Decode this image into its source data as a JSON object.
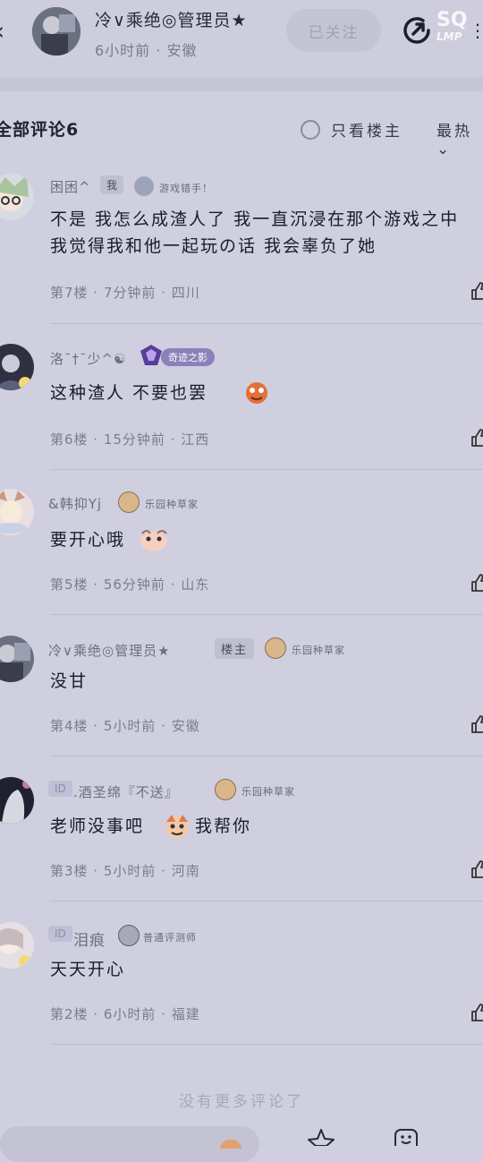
{
  "header": {
    "author_name": "冷∨乘绝◎管理员★",
    "post_meta": "6小时前 · 安徽",
    "follow_label": "已关注",
    "watermark_top": "SQ",
    "watermark_bottom": "LMP"
  },
  "comments_header": {
    "title": "全部评论6",
    "only_owner": "只看楼主",
    "sort": "最热"
  },
  "comments": [
    {
      "name": "困困^",
      "badge": "我",
      "title": "游戏错手！",
      "text": "不是 我怎么成渣人了 我一直沉浸在那个游戏之中 我觉得我和他一起玩の话 我会辜负了她",
      "meta": "第7楼 · 7分钟前 · 四川"
    },
    {
      "name": "洛ˉ†ˉ少^☯",
      "badge": "",
      "title": "奇迹之影",
      "text": "这种渣人 不要也罢",
      "meta": "第6楼 · 15分钟前 · 江西"
    },
    {
      "name": "&韩抑Yj",
      "badge": "",
      "title": "乐园种草家",
      "text": "要开心哦",
      "meta": "第5楼 · 56分钟前 · 山东"
    },
    {
      "name": "冷∨乘绝◎管理员★",
      "badge": "楼主",
      "title": "乐园种草家",
      "text": "没甘",
      "meta": "第4楼 · 5小时前 · 安徽"
    },
    {
      "name": ".酒圣绵『不送』",
      "badge": "ID",
      "title": "乐园种草家",
      "text": "老师没事吧",
      "text2": "我帮你",
      "meta": "第3楼 · 5小时前 · 河南"
    },
    {
      "name": "泪痕",
      "badge": "ID",
      "title": "普通评测师",
      "text": "天天开心",
      "meta": "第2楼 · 6小时前 · 福建"
    }
  ],
  "no_more": "没有更多评论了",
  "icons": {
    "share": "share-icon",
    "like": "thumb-up-icon",
    "star": "star-icon",
    "emoji": "emoji-icon"
  }
}
